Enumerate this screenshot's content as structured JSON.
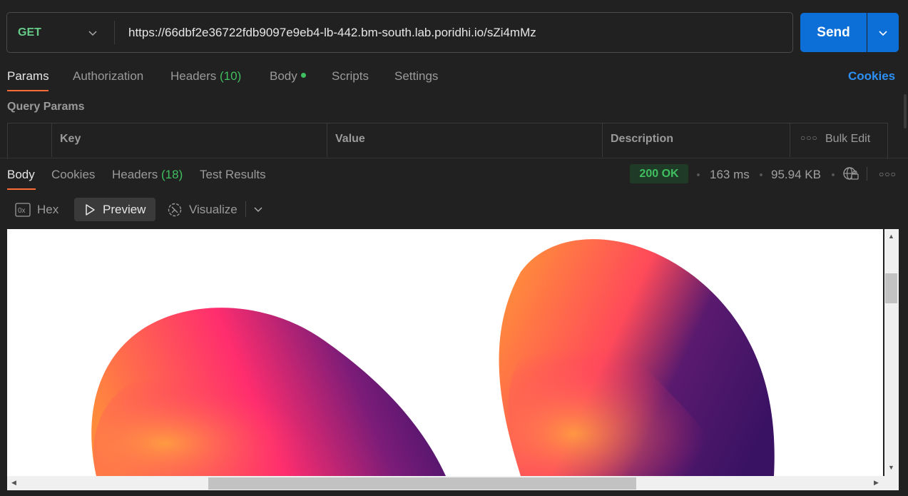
{
  "request": {
    "method": "GET",
    "url": "https://66dbf2e36722fdb9097e9eb4-lb-442.bm-south.lab.poridhi.io/sZi4mMz",
    "send_label": "Send"
  },
  "request_tabs": {
    "params": "Params",
    "authorization": "Authorization",
    "headers": "Headers",
    "headers_count": "(10)",
    "body": "Body",
    "scripts": "Scripts",
    "settings": "Settings",
    "cookies": "Cookies"
  },
  "query_params": {
    "title": "Query Params",
    "columns": [
      "Key",
      "Value",
      "Description"
    ],
    "bulk_edit": "Bulk Edit"
  },
  "response_tabs": {
    "body": "Body",
    "cookies": "Cookies",
    "headers": "Headers",
    "headers_count": "(18)",
    "test_results": "Test Results"
  },
  "response_meta": {
    "status": "200 OK",
    "time": "163 ms",
    "size": "95.94 KB"
  },
  "view_modes": {
    "hex": "Hex",
    "preview": "Preview",
    "visualize": "Visualize"
  },
  "colors": {
    "accent": "#ff6c37",
    "send": "#0c6fd7",
    "status_ok": "#3fbf5f",
    "link": "#2d90f5"
  }
}
